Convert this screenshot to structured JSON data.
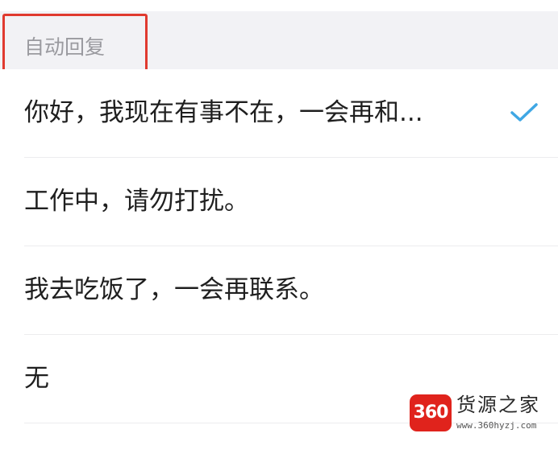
{
  "section": {
    "title": "自动回复"
  },
  "replies": [
    {
      "label": "你好，我现在有事不在，一会再和...",
      "selected": true
    },
    {
      "label": "工作中，请勿打扰。",
      "selected": false
    },
    {
      "label": "我去吃饭了，一会再联系。",
      "selected": false
    },
    {
      "label": "无",
      "selected": false
    }
  ],
  "check_icon": "checkmark-icon",
  "colors": {
    "accent": "#3fa7e4",
    "highlight": "#e03a2f",
    "section_bg": "#f2f2f5",
    "watermark_red": "#e0231c"
  },
  "watermark": {
    "logo": "360",
    "name": "货源之家",
    "url": "www.360hyzj.com"
  }
}
